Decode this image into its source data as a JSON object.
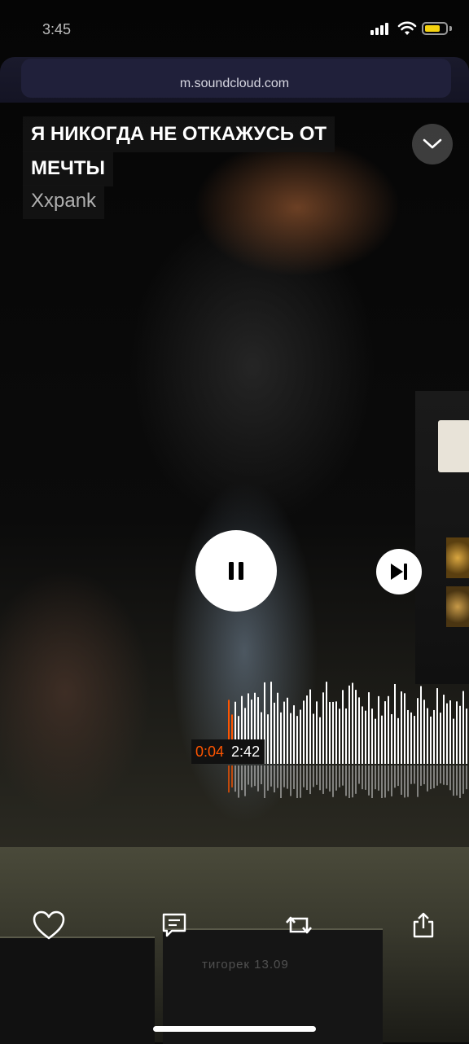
{
  "status_bar": {
    "time": "3:45"
  },
  "browser": {
    "url": "m.soundcloud.com"
  },
  "track": {
    "title_line1": "Я НИКОГДА НЕ ОТКАЖУСЬ ОТ",
    "title_line2": "МЕЧТЫ",
    "artist": "Xxpank"
  },
  "player": {
    "state": "playing",
    "current_time": "0:04",
    "total_time": "2:42",
    "progress": 0.025,
    "played_color": "#ff5500"
  },
  "actions": {
    "like_icon": "heart-icon",
    "comment_icon": "comment-icon",
    "repost_icon": "repost-icon",
    "share_icon": "share-icon"
  },
  "scene": {
    "plate_text": "тигорек 13.09"
  }
}
